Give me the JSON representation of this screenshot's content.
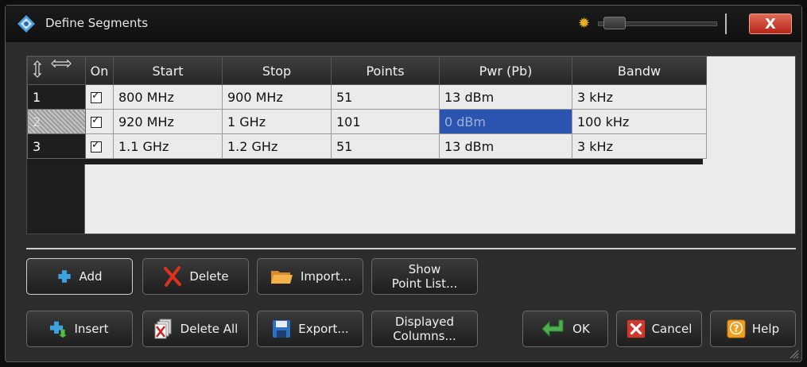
{
  "window": {
    "title": "Define Segments",
    "close_label": "X"
  },
  "table": {
    "corner_icon": "row-column-resize-icon",
    "columns": [
      "On",
      "Start",
      "Stop",
      "Points",
      "Pwr (Pb)",
      "Bandw"
    ],
    "rows": [
      {
        "num": "1",
        "on": true,
        "start": "800 MHz",
        "stop": "900 MHz",
        "points": "51",
        "pwr": "13 dBm",
        "bandw": "3 kHz"
      },
      {
        "num": "2",
        "on": true,
        "start": "920 MHz",
        "stop": "1 GHz",
        "points": "101",
        "pwr": "0 dBm",
        "bandw": "100 kHz"
      },
      {
        "num": "3",
        "on": true,
        "start": "1.1 GHz",
        "stop": "1.2 GHz",
        "points": "51",
        "pwr": "13 dBm",
        "bandw": "3 kHz"
      }
    ],
    "selected_row": "2",
    "active_cell": "Pwr (Pb)"
  },
  "buttons": {
    "add": "Add",
    "delete": "Delete",
    "import": "Import...",
    "show_point_list_1": "Show",
    "show_point_list_2": "Point List...",
    "insert": "Insert",
    "delete_all": "Delete All",
    "export": "Export...",
    "displayed_columns_1": "Displayed",
    "displayed_columns_2": "Columns...",
    "ok": "OK",
    "cancel": "Cancel",
    "help": "Help"
  },
  "colors": {
    "accent_selection": "#2a54b0",
    "close_button": "#c8382a"
  }
}
